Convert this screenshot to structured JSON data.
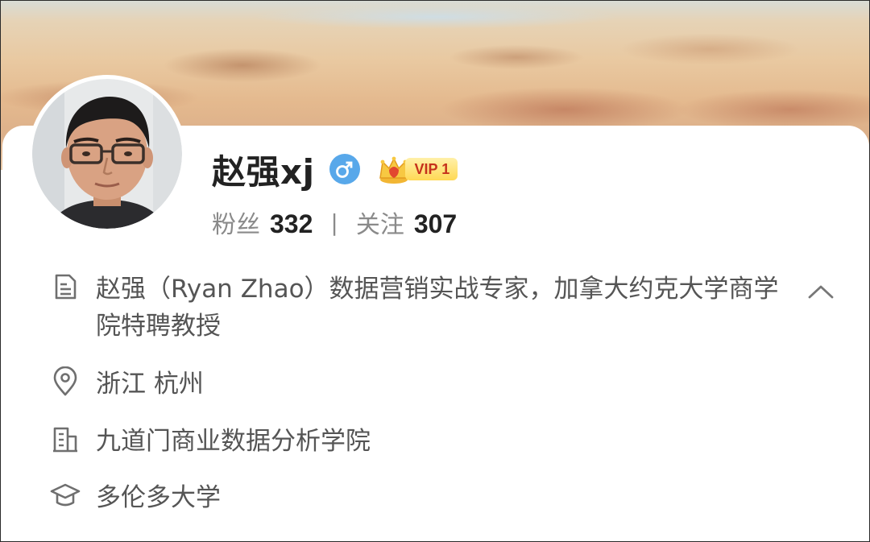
{
  "profile": {
    "name": "赵强xj",
    "vip_label": "VIP 1",
    "followers_label": "粉丝",
    "followers_count": "332",
    "separator": "|",
    "following_label": "关注",
    "following_count": "307"
  },
  "info": {
    "bio": "赵强（Ryan Zhao）数据营销实战专家，加拿大约克大学商学院特聘教授",
    "location": "浙江 杭州",
    "company": "九道门商业数据分析学院",
    "school": "多伦多大学"
  },
  "icons": {
    "gender": "male-icon",
    "vip": "crown-icon",
    "bio": "document-icon",
    "location": "location-pin-icon",
    "company": "building-icon",
    "school": "graduation-cap-icon",
    "collapse": "chevron-up-icon"
  },
  "colors": {
    "gender_bg": "#58a8ea",
    "vip_badge": "#ffd954",
    "vip_text": "#c5311c",
    "text_primary": "#222222",
    "text_secondary": "#555555"
  }
}
